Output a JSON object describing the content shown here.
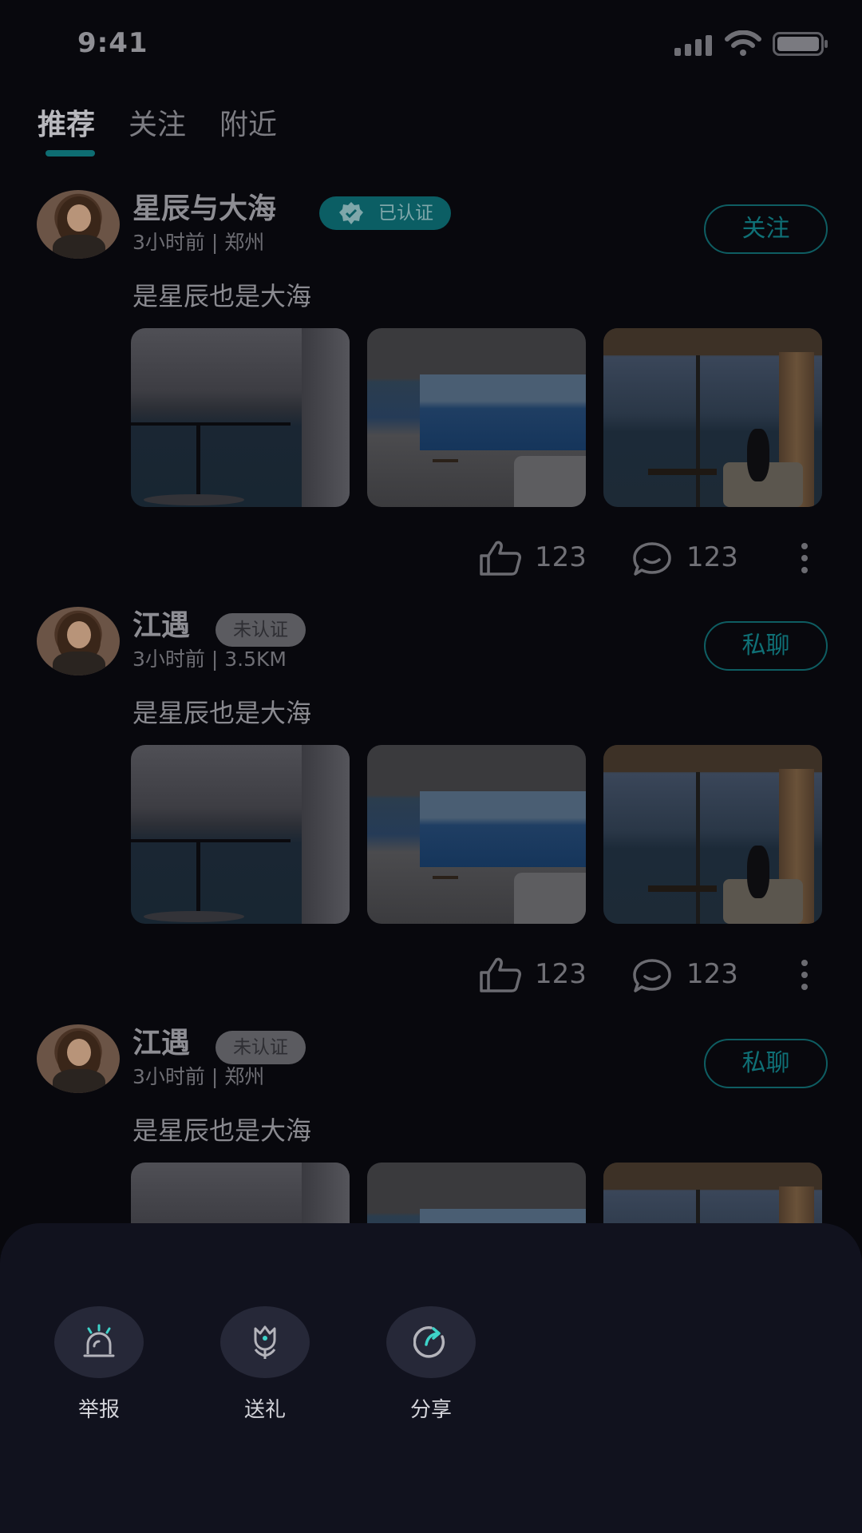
{
  "status_bar": {
    "time": "9:41"
  },
  "tabs": [
    {
      "label": "推荐",
      "active": true
    },
    {
      "label": "关注",
      "active": false
    },
    {
      "label": "附近",
      "active": false
    }
  ],
  "posts": [
    {
      "username": "星辰与大海",
      "badge": "已认证",
      "verified": true,
      "meta": "3小时前 | 郑州",
      "action": "关注",
      "text": "是星辰也是大海",
      "likes": "123",
      "comments": "123"
    },
    {
      "username": "江遇",
      "badge": "未认证",
      "verified": false,
      "meta": "3小时前 | 3.5KM",
      "action": "私聊",
      "text": "是星辰也是大海",
      "likes": "123",
      "comments": "123"
    },
    {
      "username": "江遇",
      "badge": "未认证",
      "verified": false,
      "meta": "3小时前 | 郑州",
      "action": "私聊",
      "text": "是星辰也是大海"
    }
  ],
  "sheet": {
    "items": [
      {
        "label": "举报",
        "icon": "alarm-icon"
      },
      {
        "label": "送礼",
        "icon": "flower-icon"
      },
      {
        "label": "分享",
        "icon": "share-icon"
      }
    ]
  },
  "colors": {
    "background": "#08080d",
    "accent": "#0e6d72",
    "sheet": "#11121e",
    "icon_accent": "#3ed3c9"
  }
}
